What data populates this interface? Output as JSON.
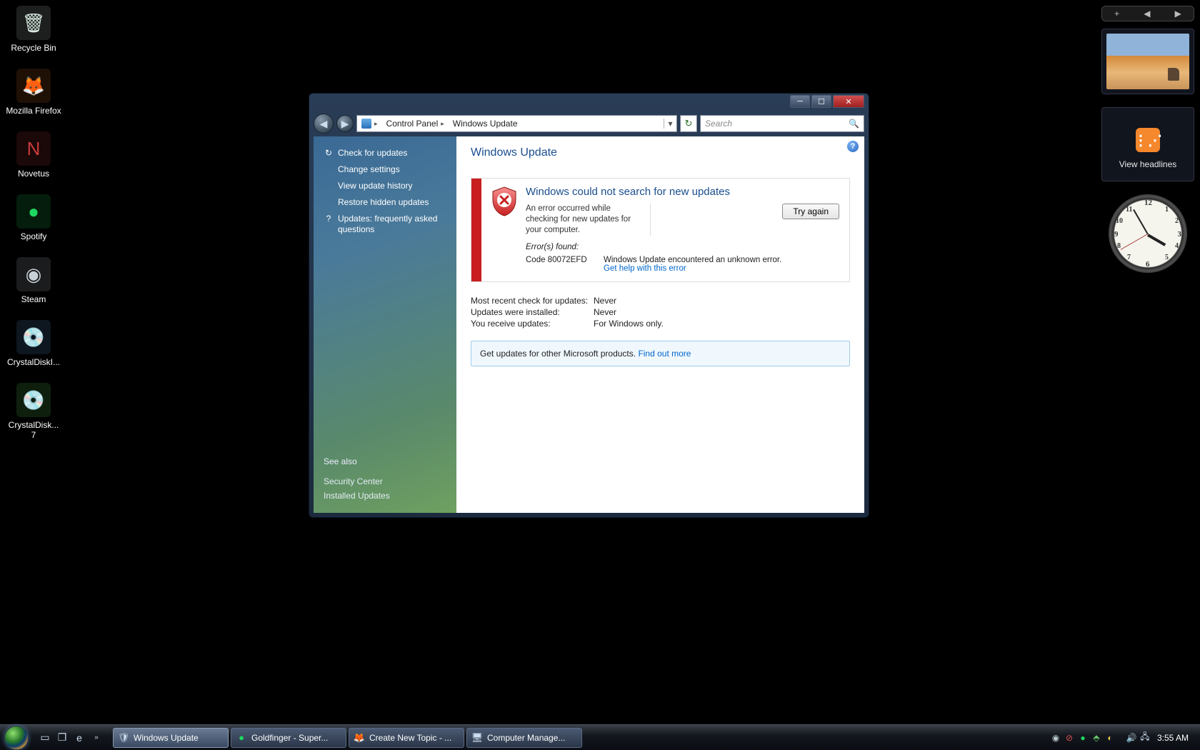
{
  "desktop_icons": [
    {
      "name": "recycle-bin",
      "label": "Recycle Bin",
      "color": "#d8e8e0",
      "glyph": "🗑"
    },
    {
      "name": "firefox",
      "label": "Mozilla Firefox",
      "color": "#e87b2a",
      "glyph": "🦊"
    },
    {
      "name": "novetus",
      "label": "Novetus",
      "color": "#c83a3a",
      "glyph": "N"
    },
    {
      "name": "spotify",
      "label": "Spotify",
      "color": "#1ed760",
      "glyph": "●"
    },
    {
      "name": "steam",
      "label": "Steam",
      "color": "#c8d0d8",
      "glyph": "◉"
    },
    {
      "name": "crystaldiskinfo",
      "label": "CrystalDiskI...",
      "color": "#6aa8e8",
      "glyph": "💿"
    },
    {
      "name": "crystaldiskinfo7",
      "label": "CrystalDisk... 7",
      "color": "#6ae86a",
      "glyph": "💿"
    }
  ],
  "gadgets": {
    "controls": {
      "plus": "+",
      "prev": "◀",
      "next": "▶"
    },
    "feed_label": "View headlines"
  },
  "window": {
    "breadcrumb": {
      "root": "Control Panel",
      "leaf": "Windows Update"
    },
    "search_placeholder": "Search",
    "sidebar": {
      "items": [
        {
          "icon": "↻",
          "label": "Check for updates"
        },
        {
          "icon": "",
          "label": "Change settings"
        },
        {
          "icon": "",
          "label": "View update history"
        },
        {
          "icon": "",
          "label": "Restore hidden updates"
        },
        {
          "icon": "?",
          "label": "Updates: frequently asked questions"
        }
      ],
      "see_also_header": "See also",
      "see_also": [
        "Security Center",
        "Installed Updates"
      ]
    },
    "content": {
      "heading": "Windows Update",
      "error_title": "Windows could not search for new updates",
      "error_msg": "An error occurred while checking for new updates for your computer.",
      "try_again": "Try again",
      "errors_found": "Error(s) found:",
      "error_code": "Code 80072EFD",
      "error_desc": "Windows Update encountered an unknown error.",
      "get_help": "Get help with this error",
      "status": [
        {
          "label": "Most recent check for updates:",
          "value": "Never"
        },
        {
          "label": "Updates were installed:",
          "value": "Never"
        },
        {
          "label": "You receive updates:",
          "value": "For Windows only."
        }
      ],
      "info_prefix": "Get updates for other Microsoft products. ",
      "info_link": "Find out more"
    }
  },
  "taskbar": {
    "quicklaunch": [
      {
        "name": "show-desktop",
        "glyph": "▭"
      },
      {
        "name": "switch-windows",
        "glyph": "❐"
      },
      {
        "name": "ie",
        "glyph": "e"
      }
    ],
    "tasks": [
      {
        "name": "windows-update",
        "label": "Windows Update",
        "glyph": "🛡",
        "active": true
      },
      {
        "name": "spotify-playing",
        "label": "Goldfinger - Super...",
        "glyph": "●",
        "active": false,
        "color": "#1ed760"
      },
      {
        "name": "firefox-topic",
        "label": "Create New Topic - ...",
        "glyph": "🦊",
        "active": false
      },
      {
        "name": "computer-mgmt",
        "label": "Computer Manage...",
        "glyph": "🖥",
        "active": false
      }
    ],
    "tray_icons": [
      {
        "name": "steam",
        "glyph": "◉",
        "color": "#bcc"
      },
      {
        "name": "error",
        "glyph": "⊘",
        "color": "#e05050"
      },
      {
        "name": "spotify",
        "glyph": "●",
        "color": "#1ed760"
      },
      {
        "name": "security",
        "glyph": "⬘",
        "color": "#6ac86a"
      },
      {
        "name": "update",
        "glyph": "◐",
        "color": "#e8c84a"
      }
    ],
    "tray_icons2": [
      {
        "name": "network",
        "glyph": "🖧",
        "color": "#cde"
      },
      {
        "name": "volume",
        "glyph": "🔊",
        "color": "#cde"
      }
    ],
    "clock": "3:55 AM"
  }
}
